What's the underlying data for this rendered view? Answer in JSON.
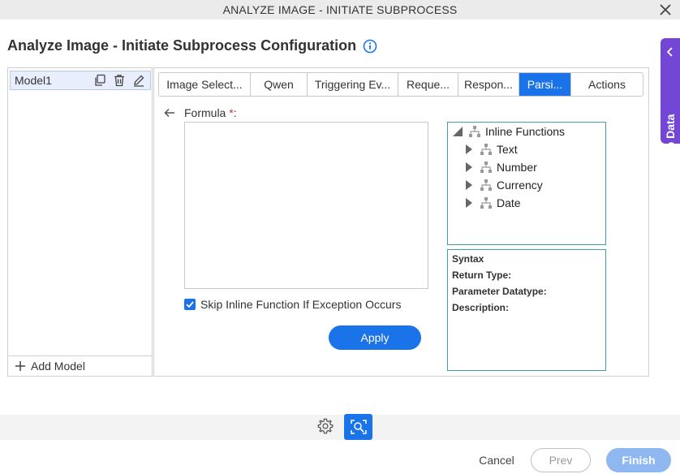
{
  "window": {
    "title": "ANALYZE IMAGE - INITIATE SUBPROCESS",
    "close_icon": "close-icon"
  },
  "page": {
    "title": "Analyze Image - Initiate Subprocess Configuration",
    "info_icon": "info-icon"
  },
  "side_tab": {
    "label": "App Data",
    "icon": "chevron-left-icon"
  },
  "models": {
    "items": [
      {
        "label": "Model1"
      }
    ],
    "add_label": "Add Model"
  },
  "tabs": [
    {
      "label": "Image Select..."
    },
    {
      "label": "Qwen"
    },
    {
      "label": "Triggering Ev..."
    },
    {
      "label": "Reque..."
    },
    {
      "label": "Respon..."
    },
    {
      "label": "Parsi..."
    },
    {
      "label": "Actions"
    }
  ],
  "active_tab": "Parsi...",
  "formula": {
    "label": "Formula",
    "required_mark": "*",
    "label_suffix": ":",
    "value": ""
  },
  "skip_option": {
    "label": "Skip Inline Function If Exception Occurs",
    "checked": true
  },
  "apply_label": "Apply",
  "tree": {
    "root": "Inline Functions",
    "children": [
      {
        "label": "Text"
      },
      {
        "label": "Number"
      },
      {
        "label": "Currency"
      },
      {
        "label": "Date"
      }
    ]
  },
  "syntax_panel": {
    "syntax": "Syntax",
    "return_type": "Return Type:",
    "parameter_datatype": "Parameter Datatype:",
    "description": "Description:"
  },
  "footer": {
    "cancel": "Cancel",
    "prev": "Prev",
    "finish": "Finish"
  },
  "colors": {
    "accent": "#1a73e8",
    "side_tab": "#7446d6",
    "finish_disabled": "#8fb8f0"
  }
}
